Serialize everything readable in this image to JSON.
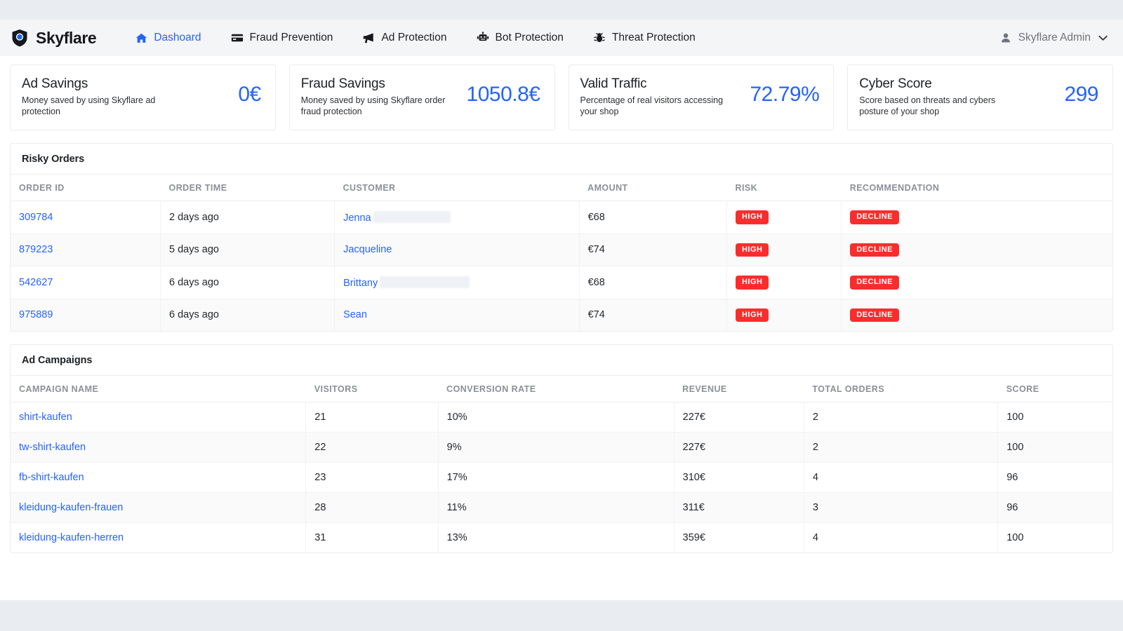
{
  "brand": {
    "name": "Skyflare",
    "logo_icon": "shield-dot-logo"
  },
  "nav": {
    "items": [
      {
        "label": "Dashoard",
        "icon": "home-icon",
        "active": true
      },
      {
        "label": "Fraud Prevention",
        "icon": "credit-card-icon",
        "active": false
      },
      {
        "label": "Ad Protection",
        "icon": "megaphone-icon",
        "active": false
      },
      {
        "label": "Bot Protection",
        "icon": "robot-icon",
        "active": false
      },
      {
        "label": "Threat Protection",
        "icon": "bug-icon",
        "active": false
      }
    ],
    "user": {
      "label": "Skyflare Admin",
      "icon": "user-icon",
      "caret": "⌄"
    }
  },
  "colors": {
    "accent": "#2563ff",
    "danger": "#fa2d2d",
    "page_bg": "#e9edf1",
    "navbar_bg": "#f4f5f6"
  },
  "cards": [
    {
      "title": "Ad Savings",
      "desc": "Money saved by using Skyflare ad protection",
      "value": "0€"
    },
    {
      "title": "Fraud Savings",
      "desc": "Money saved by using Skyflare order fraud protection",
      "value": "1050.8€"
    },
    {
      "title": "Valid Traffic",
      "desc": "Percentage of real visitors accessing your shop",
      "value": "72.79%"
    },
    {
      "title": "Cyber Score",
      "desc": "Score based on threats and cybers posture of your shop",
      "value": "299"
    }
  ],
  "risky_orders": {
    "title": "Risky Orders",
    "columns": [
      "ORDER ID",
      "ORDER TIME",
      "CUSTOMER",
      "AMOUNT",
      "RISK",
      "RECOMMENDATION"
    ],
    "rows": [
      {
        "order_id": "309784",
        "order_time": "2 days ago",
        "customer": "Jenna",
        "redacted_width": 110,
        "amount": "€68",
        "risk": "HIGH",
        "recommendation": "DECLINE"
      },
      {
        "order_id": "879223",
        "order_time": "5 days ago",
        "customer": "Jacqueline",
        "redacted_width": 0,
        "amount": "€74",
        "risk": "HIGH",
        "recommendation": "DECLINE"
      },
      {
        "order_id": "542627",
        "order_time": "6 days ago",
        "customer": "Brittany",
        "redacted_width": 128,
        "amount": "€68",
        "risk": "HIGH",
        "recommendation": "DECLINE"
      },
      {
        "order_id": "975889",
        "order_time": "6 days ago",
        "customer": "Sean",
        "redacted_width": 0,
        "amount": "€74",
        "risk": "HIGH",
        "recommendation": "DECLINE"
      }
    ]
  },
  "ad_campaigns": {
    "title": "Ad Campaigns",
    "columns": [
      "CAMPAIGN NAME",
      "VISITORS",
      "CONVERSION RATE",
      "REVENUE",
      "TOTAL ORDERS",
      "SCORE"
    ],
    "rows": [
      {
        "name": "shirt-kaufen",
        "visitors": "21",
        "conversion_rate": "10%",
        "revenue": "227€",
        "total_orders": "2",
        "score": "100"
      },
      {
        "name": "tw-shirt-kaufen",
        "visitors": "22",
        "conversion_rate": "9%",
        "revenue": "227€",
        "total_orders": "2",
        "score": "100"
      },
      {
        "name": "fb-shirt-kaufen",
        "visitors": "23",
        "conversion_rate": "17%",
        "revenue": "310€",
        "total_orders": "4",
        "score": "96"
      },
      {
        "name": "kleidung-kaufen-frauen",
        "visitors": "28",
        "conversion_rate": "11%",
        "revenue": "311€",
        "total_orders": "3",
        "score": "96"
      },
      {
        "name": "kleidung-kaufen-herren",
        "visitors": "31",
        "conversion_rate": "13%",
        "revenue": "359€",
        "total_orders": "4",
        "score": "100"
      }
    ]
  }
}
